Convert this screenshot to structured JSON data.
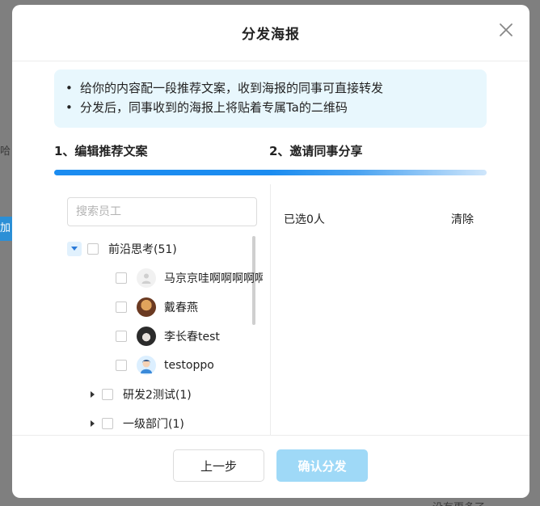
{
  "background": {
    "fragment_left": "哈",
    "fragment_button": "加",
    "fragment_bottom": "没有更多了"
  },
  "modal": {
    "title": "分发海报",
    "tips": [
      "给你的内容配一段推荐文案，收到海报的同事可直接转发",
      "分发后，同事收到的海报上将贴着专属Ta的二维码"
    ],
    "steps": {
      "step1": "1、编辑推荐文案",
      "step2": "2、邀请同事分享"
    },
    "search_placeholder": "搜索员工",
    "tree": {
      "root": "前沿思考(51)",
      "members": [
        "马京京哇啊啊啊啊啊",
        "戴春燕",
        "李长春test",
        "testoppo"
      ],
      "depts": [
        "研发2测试(1)",
        "一级部门(1)"
      ]
    },
    "selected_label": "已选0人",
    "clear_label": "清除",
    "prev_label": "上一步",
    "confirm_label": "确认分发"
  },
  "colors": {
    "accent": "#1b8cf0",
    "confirm_disabled": "#9fd9f7",
    "tips_bg": "#e8f7fd"
  }
}
